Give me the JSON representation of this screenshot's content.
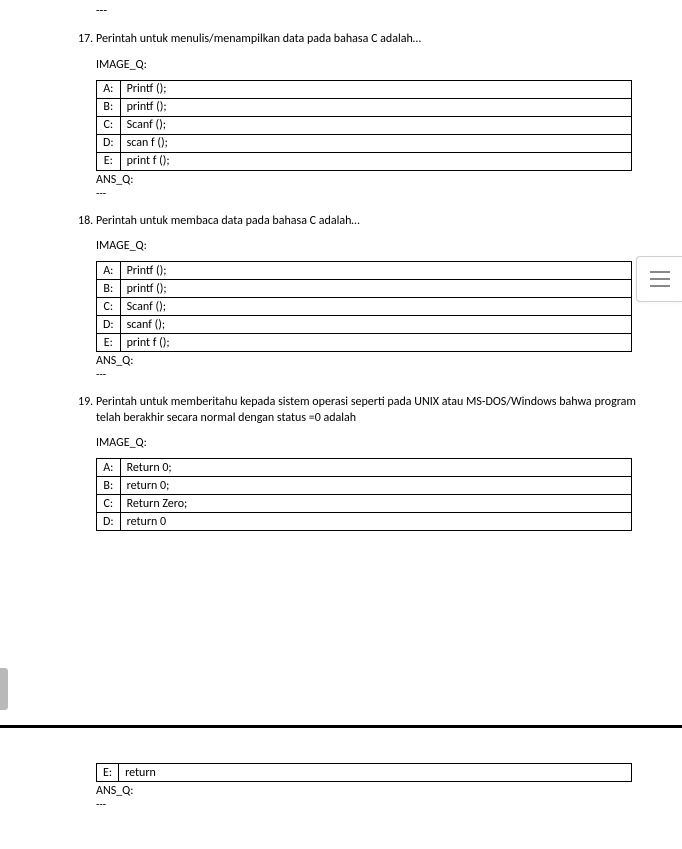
{
  "top_dashes": "---",
  "questions": [
    {
      "number": "17.",
      "text": "Perintah untuk menulis/menampilkan data pada bahasa C adalah…",
      "image_label": "IMAGE_Q:",
      "options": [
        {
          "letter": "A:",
          "value": "Printf ();"
        },
        {
          "letter": "B:",
          "value": "printf ();"
        },
        {
          "letter": "C:",
          "value": "Scanf ();"
        },
        {
          "letter": "D:",
          "value": "scan f ();"
        },
        {
          "letter": "E:",
          "value": "print f ();"
        }
      ],
      "ans_label": "ANS_Q:",
      "ans_dashes": "---"
    },
    {
      "number": "18.",
      "text": "Perintah untuk membaca data pada bahasa C adalah…",
      "image_label": "IMAGE_Q:",
      "options": [
        {
          "letter": "A:",
          "value": "Printf ();"
        },
        {
          "letter": "B:",
          "value": "printf ();"
        },
        {
          "letter": "C:",
          "value": "Scanf ();"
        },
        {
          "letter": "D:",
          "value": "scanf ();"
        },
        {
          "letter": "E:",
          "value": "print f ();"
        }
      ],
      "ans_label": "ANS_Q:",
      "ans_dashes": "---"
    },
    {
      "number": "19.",
      "text": "Perintah untuk memberitahu kepada sistem operasi seperti pada UNIX atau MS-DOS/Windows bahwa program telah berakhir secara normal dengan status =0 adalah",
      "image_label": "IMAGE_Q:",
      "options": [
        {
          "letter": "A:",
          "value": "Return 0;"
        },
        {
          "letter": "B:",
          "value": "return 0;"
        },
        {
          "letter": "C:",
          "value": "Return Zero;"
        },
        {
          "letter": "D:",
          "value": "return 0"
        }
      ],
      "ans_label": "",
      "ans_dashes": ""
    }
  ],
  "page2": {
    "option": {
      "letter": "E:",
      "value": "return"
    },
    "ans_label": "ANS_Q:",
    "ans_dashes": "---"
  }
}
